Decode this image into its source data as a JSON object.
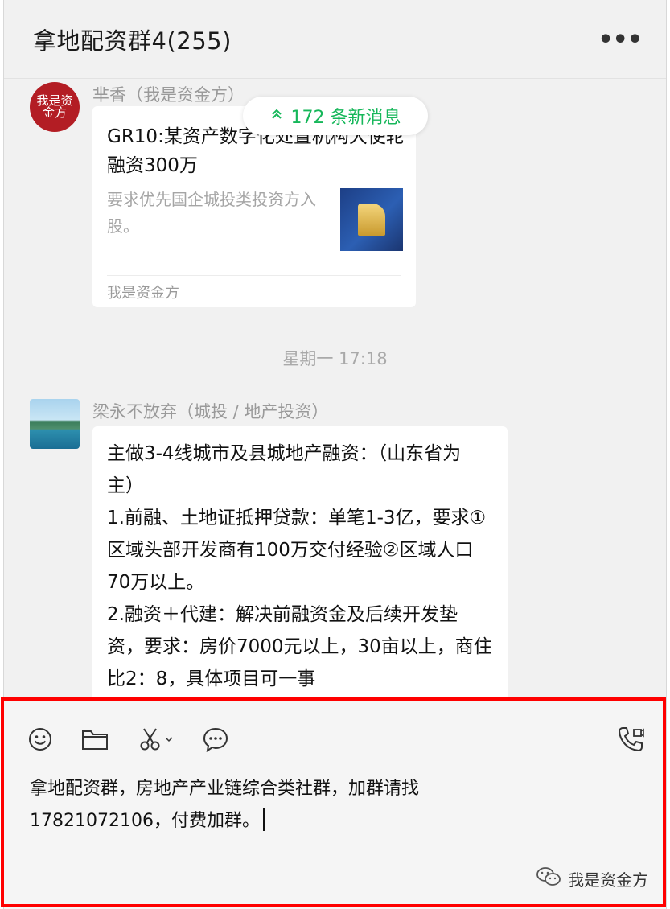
{
  "header": {
    "title": "拿地配资群4(255)",
    "more_label": "•••"
  },
  "new_messages_pill": {
    "label": "172 条新消息"
  },
  "messages": [
    {
      "sender": "芈香（我是资金方）",
      "avatar_text": "我是资金方",
      "card": {
        "title": "GR10:某资产数字化处置机构大使轮融资300万",
        "description": "要求优先国企城投类投资方入股。",
        "source": "我是资金方"
      }
    },
    {
      "time": "星期一 17:18"
    },
    {
      "sender": "梁永不放弃（城投 / 地产投资）",
      "text": "主做3-4线城市及县城地产融资：（山东省为主）\n1.前融、土地证抵押贷款：单笔1-3亿，要求①区域头部开发商有100万交付经验②区域人口70万以上。\n2.融资＋代建：解决前融资金及后续开发垫资，要求：房价7000元以上，30亩以上，商住比2：8，具体项目可一事"
    }
  ],
  "toolbar": {
    "icons": [
      "emoji-icon",
      "folder-icon",
      "scissors-icon",
      "chat-history-icon",
      "call-icon"
    ]
  },
  "input": {
    "text": "拿地配资群，房地产产业链综合类社群，加群请找17821072106，付费加群。"
  },
  "watermark": {
    "label": "我是资金方"
  },
  "colors": {
    "accent_green": "#16b75a",
    "highlight_red": "#ff0000",
    "avatar_red": "#b31d24"
  }
}
